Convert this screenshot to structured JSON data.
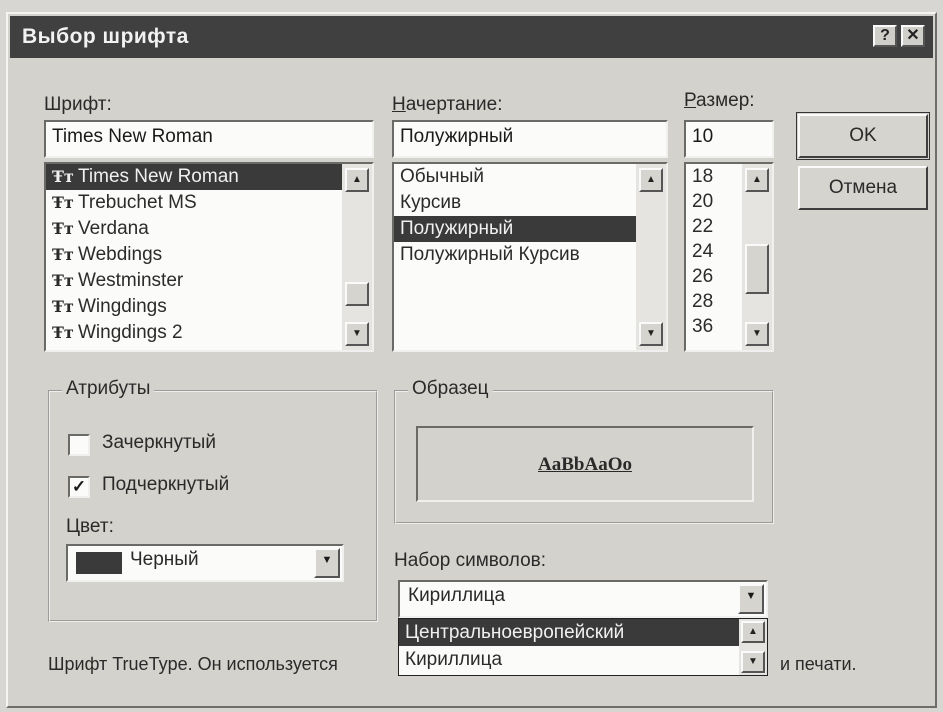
{
  "window": {
    "title": "Выбор шрифта",
    "help_label": "?",
    "close_label": "✕"
  },
  "font": {
    "label": "Шрифт:",
    "value": "Times New Roman",
    "icon": "truetype-icon",
    "icon_glyph": "Ŧт",
    "items": [
      {
        "label": "Times New Roman",
        "selected": true
      },
      {
        "label": "Trebuchet MS",
        "selected": false
      },
      {
        "label": "Verdana",
        "selected": false
      },
      {
        "label": "Webdings",
        "selected": false
      },
      {
        "label": "Westminster",
        "selected": false
      },
      {
        "label": "Wingdings",
        "selected": false
      },
      {
        "label": "Wingdings 2",
        "selected": false
      }
    ]
  },
  "style": {
    "label": "Начертание:",
    "value": "Полужирный",
    "items": [
      {
        "label": "Обычный",
        "selected": false
      },
      {
        "label": "Курсив",
        "selected": false
      },
      {
        "label": "Полужирный",
        "selected": true
      },
      {
        "label": "Полужирный Курсив",
        "selected": false
      }
    ]
  },
  "size": {
    "label": "Размер:",
    "value": "10",
    "items": [
      "18",
      "20",
      "22",
      "24",
      "26",
      "28",
      "36"
    ]
  },
  "buttons": {
    "ok": "OK",
    "cancel": "Отмена"
  },
  "attributes": {
    "title": "Атрибуты",
    "strikeout": {
      "label": "Зачеркнутый",
      "checked": false
    },
    "underline": {
      "label": "Подчеркнутый",
      "checked": true
    },
    "color_label": "Цвет:",
    "color_value": "Черный",
    "color_swatch": "#3a3a3a",
    "check_mark": "✓"
  },
  "sample": {
    "title": "Образец",
    "text": "AaBbAaOo"
  },
  "charset": {
    "label": "Набор символов:",
    "value": "Кириллица",
    "options": [
      {
        "label": "Центральноевропейский",
        "selected": true
      },
      {
        "label": "Кириллица",
        "selected": false
      }
    ]
  },
  "footer": {
    "left": "Шрифт TrueType. Он используется",
    "right": "и печати."
  },
  "glyphs": {
    "up": "▲",
    "down": "▼"
  }
}
